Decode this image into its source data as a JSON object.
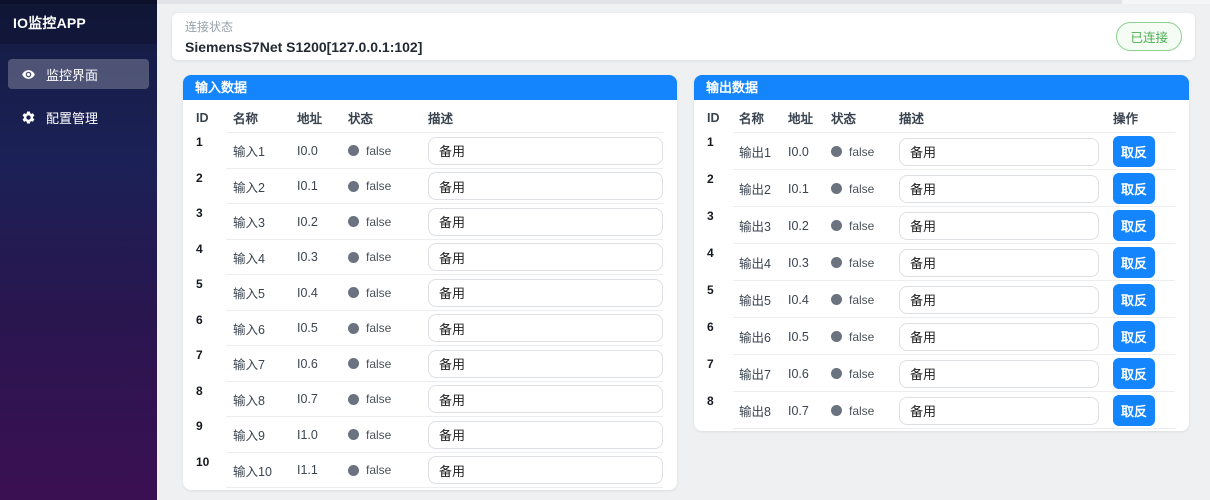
{
  "app": {
    "title": "IO监控APP"
  },
  "sidebar": {
    "items": [
      {
        "label": "监控界面",
        "icon": "eye-icon",
        "active": true
      },
      {
        "label": "配置管理",
        "icon": "gear-icon",
        "active": false
      }
    ]
  },
  "connection_bar": {
    "label": "连接状态",
    "value": "SiemensS7Net S1200[127.0.0.1:102]",
    "status_badge": "已连接"
  },
  "panels": {
    "input": {
      "title": "输入数据",
      "columns": [
        {
          "label": "ID"
        },
        {
          "label": "名称"
        },
        {
          "label": "地址"
        },
        {
          "label": "状态"
        },
        {
          "label": "描述"
        }
      ],
      "rows": [
        {
          "id": "1",
          "name": "输入1",
          "address": "I0.0",
          "status": "false",
          "desc": "备用"
        },
        {
          "id": "2",
          "name": "输入2",
          "address": "I0.1",
          "status": "false",
          "desc": "备用"
        },
        {
          "id": "3",
          "name": "输入3",
          "address": "I0.2",
          "status": "false",
          "desc": "备用"
        },
        {
          "id": "4",
          "name": "输入4",
          "address": "I0.3",
          "status": "false",
          "desc": "备用"
        },
        {
          "id": "5",
          "name": "输入5",
          "address": "I0.4",
          "status": "false",
          "desc": "备用"
        },
        {
          "id": "6",
          "name": "输入6",
          "address": "I0.5",
          "status": "false",
          "desc": "备用"
        },
        {
          "id": "7",
          "name": "输入7",
          "address": "I0.6",
          "status": "false",
          "desc": "备用"
        },
        {
          "id": "8",
          "name": "输入8",
          "address": "I0.7",
          "status": "false",
          "desc": "备用"
        },
        {
          "id": "9",
          "name": "输入9",
          "address": "I1.0",
          "status": "false",
          "desc": "备用"
        },
        {
          "id": "10",
          "name": "输入10",
          "address": "I1.1",
          "status": "false",
          "desc": "备用"
        }
      ]
    },
    "output": {
      "title": "输出数据",
      "invert_label": "取反",
      "columns": [
        {
          "label": "ID"
        },
        {
          "label": "名称"
        },
        {
          "label": "地址"
        },
        {
          "label": "状态"
        },
        {
          "label": "描述"
        },
        {
          "label": "操作"
        }
      ],
      "rows": [
        {
          "id": "1",
          "name": "输出1",
          "address": "I0.0",
          "status": "false",
          "desc": "备用"
        },
        {
          "id": "2",
          "name": "输出2",
          "address": "I0.1",
          "status": "false",
          "desc": "备用"
        },
        {
          "id": "3",
          "name": "输出3",
          "address": "I0.2",
          "status": "false",
          "desc": "备用"
        },
        {
          "id": "4",
          "name": "输出4",
          "address": "I0.3",
          "status": "false",
          "desc": "备用"
        },
        {
          "id": "5",
          "name": "输出5",
          "address": "I0.4",
          "status": "false",
          "desc": "备用"
        },
        {
          "id": "6",
          "name": "输出6",
          "address": "I0.5",
          "status": "false",
          "desc": "备用"
        },
        {
          "id": "7",
          "name": "输出7",
          "address": "I0.6",
          "status": "false",
          "desc": "备用"
        },
        {
          "id": "8",
          "name": "输出8",
          "address": "I0.7",
          "status": "false",
          "desc": "备用"
        }
      ]
    }
  },
  "colors": {
    "accent_blue": "#1485fd",
    "status_dot_gray": "#6b7280",
    "badge_green": "#4caf50"
  }
}
